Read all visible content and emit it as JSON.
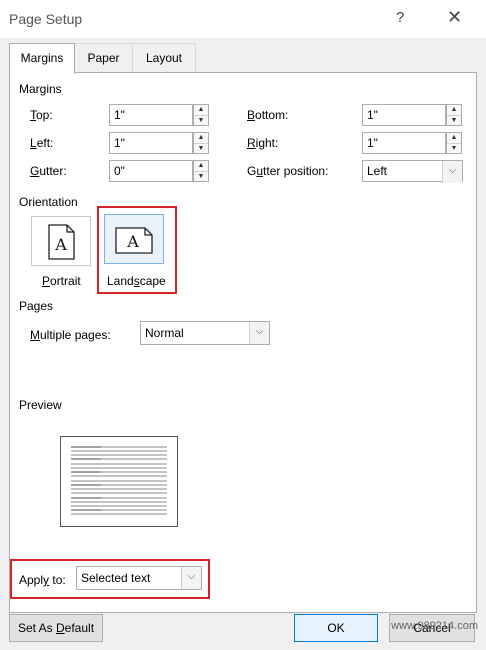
{
  "window": {
    "title": "Page Setup",
    "help_glyph": "?",
    "close_glyph": "✕"
  },
  "tabs": [
    {
      "label": "Margins",
      "active": true
    },
    {
      "label": "Paper",
      "active": false
    },
    {
      "label": "Layout",
      "active": false
    }
  ],
  "margins": {
    "heading": "Margins",
    "top": {
      "label_u": "T",
      "label_rest": "op:",
      "value": "1\""
    },
    "left": {
      "label_u": "L",
      "label_rest": "eft:",
      "value": "1\""
    },
    "gutter": {
      "label_u": "G",
      "label_rest": "utter:",
      "value": "0\""
    },
    "bottom": {
      "label_u": "B",
      "label_rest": "ottom:",
      "value": "1\""
    },
    "right": {
      "label_u": "R",
      "label_rest": "ight:",
      "value": "1\""
    },
    "gutter_position": {
      "label_pre": "G",
      "label_u": "u",
      "label_rest": "tter position:",
      "value": "Left"
    }
  },
  "orientation": {
    "heading": "Orientation",
    "portrait": {
      "label_u": "P",
      "label_rest": "ortrait",
      "glyph": "A"
    },
    "landscape": {
      "label_pre": "Land",
      "label_u": "s",
      "label_rest": "cape",
      "glyph": "A",
      "selected": true
    }
  },
  "pages": {
    "heading": "Pages",
    "multiple_label_u": "M",
    "multiple_label_rest": "ultiple pages:",
    "multiple_value": "Normal"
  },
  "preview": {
    "heading": "Preview"
  },
  "apply_to": {
    "label_pre": "Appl",
    "label_u": "y",
    "label_rest": " to:",
    "value": "Selected text"
  },
  "buttons": {
    "default_pre": "Set As ",
    "default_u": "D",
    "default_rest": "efault",
    "ok": "OK",
    "cancel": "Cancel"
  },
  "watermark": "www.989214.com",
  "colors": {
    "highlight": "#d4242a",
    "primary_border": "#0078d7"
  }
}
